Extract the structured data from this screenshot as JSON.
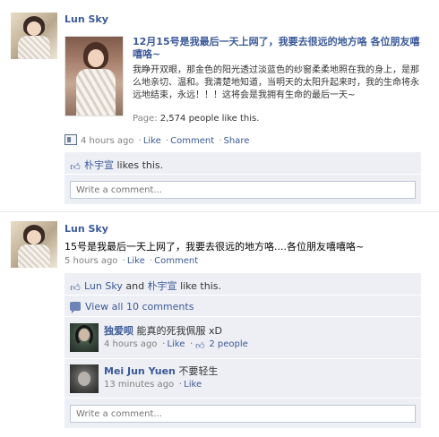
{
  "stories": [
    {
      "author": "Lun Sky",
      "attachment": {
        "title": "12月15号是我最后一天上网了，我要去很远的地方咯 各位朋友嘻嘻咯~",
        "description": "我睁开双眼，那金色的阳光透过淡蓝色的纱窗柔柔地照在我的身上，是那么地亲切、温和。我清楚地知道，当明天的太阳升起来时，我的生命将永远地结束，永远！！！这将会是我拥有生命的最后一天~",
        "likes_prefix": "Page:",
        "likes_text": "2,574 people like this."
      },
      "time": "4 hours ago",
      "actions": [
        "Like",
        "Comment",
        "Share"
      ],
      "likes": {
        "names": "朴宇宣",
        "suffix": "likes this."
      },
      "comment_placeholder": "Write a comment..."
    },
    {
      "author": "Lun Sky",
      "message": "15号是我最后一天上网了，我要去很远的地方咯....各位朋友嘻嘻咯~",
      "time": "5 hours ago",
      "actions": [
        "Like",
        "Comment"
      ],
      "likes": {
        "name1": "Lun Sky",
        "and": "and",
        "name2": "朴宇宣",
        "suffix": "like this."
      },
      "view_all": "View all 10 comments",
      "comments": [
        {
          "author": "独爱呗",
          "text": "能真的死我佩服 xD",
          "time": "4 hours ago",
          "like": "Like",
          "like_count": "2 people"
        },
        {
          "author": "Mei Jun Yuen",
          "text": "不要轻生",
          "time": "13 minutes ago",
          "like": "Like"
        }
      ],
      "comment_placeholder": "Write a comment..."
    }
  ],
  "separator": "·",
  "icons": {
    "like": "thumbs-up-icon",
    "comment": "comment-bubble-icon",
    "mobile": "mobile-post-icon"
  },
  "colors": {
    "link": "#3b5998",
    "ufi_bg": "#edeff4",
    "meta": "#808080"
  }
}
